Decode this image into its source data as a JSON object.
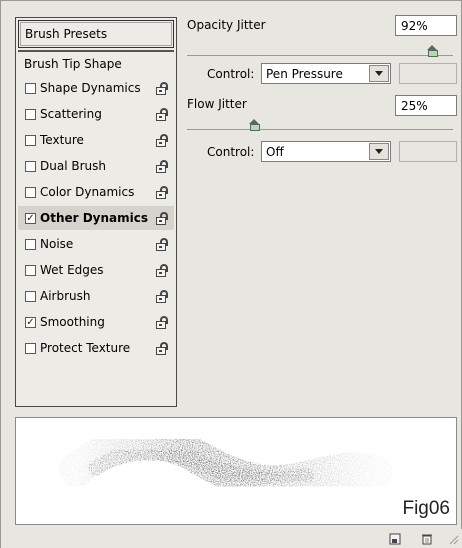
{
  "sidebar": {
    "presets_label": "Brush Presets",
    "tip_shape_label": "Brush Tip Shape",
    "items": [
      {
        "label": "Shape Dynamics",
        "checked": false,
        "selected": false
      },
      {
        "label": "Scattering",
        "checked": false,
        "selected": false
      },
      {
        "label": "Texture",
        "checked": false,
        "selected": false
      },
      {
        "label": "Dual Brush",
        "checked": false,
        "selected": false
      },
      {
        "label": "Color Dynamics",
        "checked": false,
        "selected": false
      },
      {
        "label": "Other Dynamics",
        "checked": true,
        "selected": true
      },
      {
        "label": "Noise",
        "checked": false,
        "selected": false
      },
      {
        "label": "Wet Edges",
        "checked": false,
        "selected": false
      },
      {
        "label": "Airbrush",
        "checked": false,
        "selected": false
      },
      {
        "label": "Smoothing",
        "checked": true,
        "selected": false
      },
      {
        "label": "Protect Texture",
        "checked": false,
        "selected": false
      }
    ]
  },
  "opacity": {
    "label": "Opacity Jitter",
    "value": "92%",
    "level": 0.92,
    "control_label": "Control:",
    "control_value": "Pen Pressure"
  },
  "flow": {
    "label": "Flow Jitter",
    "value": "25%",
    "level": 0.25,
    "control_label": "Control:",
    "control_value": "Off"
  },
  "preview": {
    "fig_label": "Fig06"
  },
  "icons": {
    "lock": "lock-icon",
    "dropdown": "chevron-down-icon",
    "new_preset": "new-preset-icon",
    "delete": "trash-icon"
  }
}
